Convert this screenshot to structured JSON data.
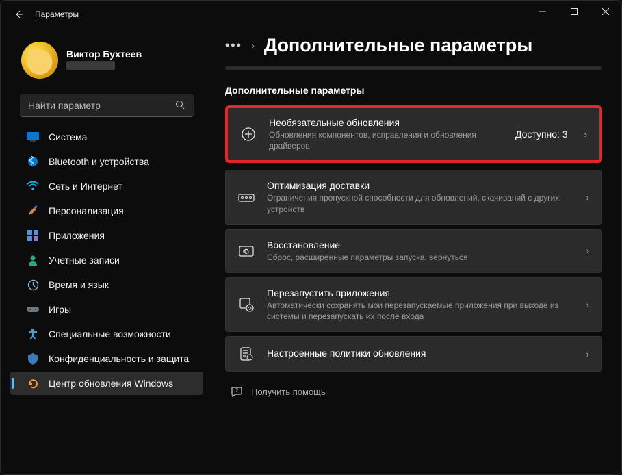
{
  "window": {
    "title": "Параметры"
  },
  "profile": {
    "name": "Виктор Бухтеев",
    "email": ""
  },
  "search": {
    "placeholder": "Найти параметр"
  },
  "sidebar": {
    "items": [
      {
        "label": "Система"
      },
      {
        "label": "Bluetooth и устройства"
      },
      {
        "label": "Сеть и Интернет"
      },
      {
        "label": "Персонализация"
      },
      {
        "label": "Приложения"
      },
      {
        "label": "Учетные записи"
      },
      {
        "label": "Время и язык"
      },
      {
        "label": "Игры"
      },
      {
        "label": "Специальные возможности"
      },
      {
        "label": "Конфиденциальность и защита"
      },
      {
        "label": "Центр обновления Windows"
      }
    ]
  },
  "page": {
    "title": "Дополнительные параметры",
    "section": "Дополнительные параметры"
  },
  "cards": [
    {
      "title": "Необязательные обновления",
      "sub": "Обновления компонентов, исправления и обновления драйверов",
      "right": "Доступно: 3"
    },
    {
      "title": "Оптимизация доставки",
      "sub": "Ограничения пропускной способности для обновлений, скачиваний с других устройств"
    },
    {
      "title": "Восстановление",
      "sub": "Сброс, расширенные параметры запуска, вернуться"
    },
    {
      "title": "Перезапустить приложения",
      "sub": "Автоматически сохранять мои перезапускаемые приложения при выходе из системы и перезапускать их после входа"
    },
    {
      "title": "Настроенные политики обновления",
      "sub": ""
    }
  ],
  "help": {
    "label": "Получить помощь"
  }
}
